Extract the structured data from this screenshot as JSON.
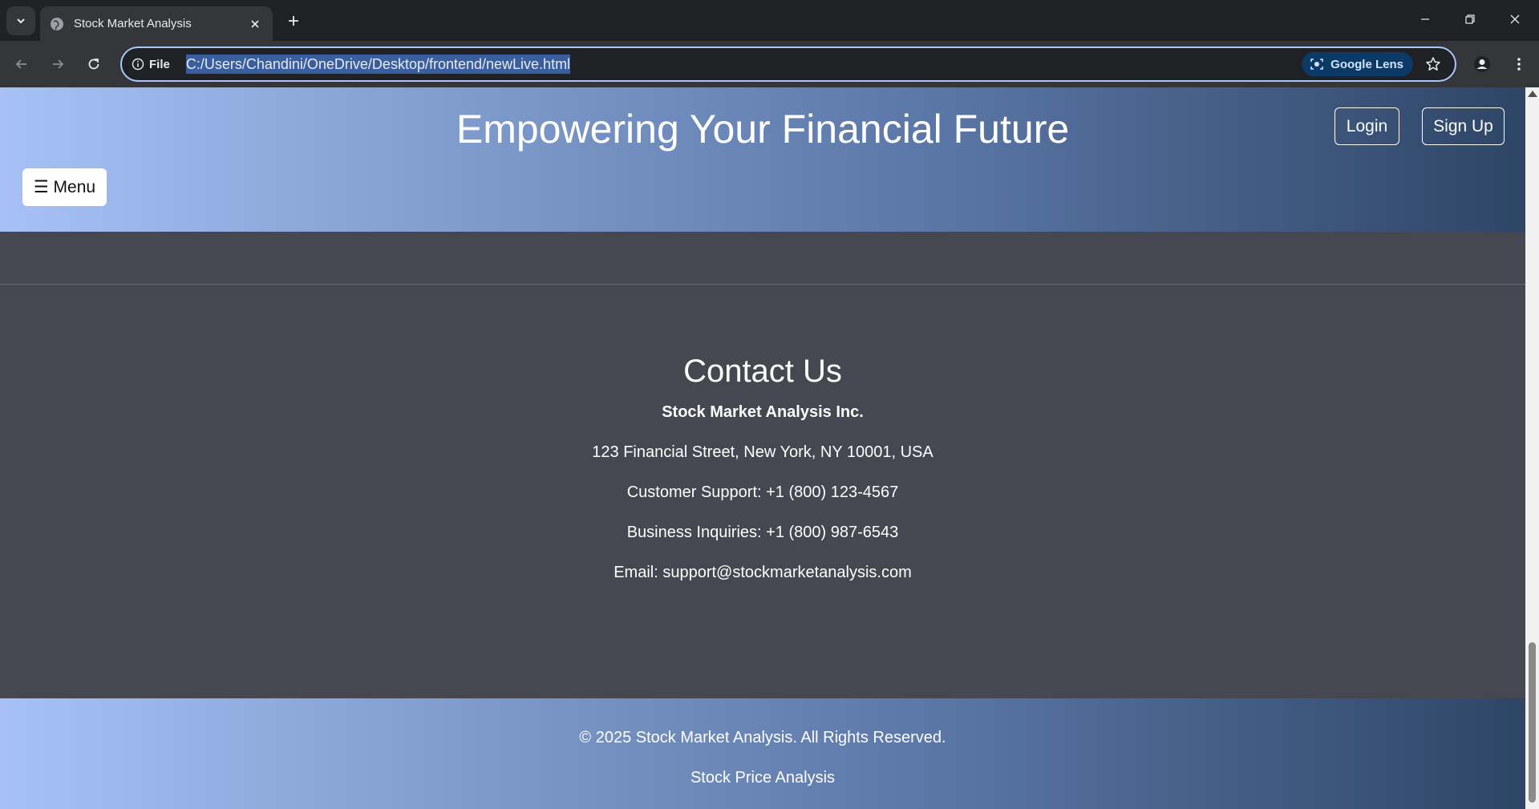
{
  "browser": {
    "tab_title": "Stock Market Analysis",
    "site_info_label": "File",
    "url": "C:/Users/Chandini/OneDrive/Desktop/frontend/newLive.html",
    "lens_label": "Google Lens"
  },
  "header": {
    "title": "Empowering Your Financial Future",
    "login_label": "Login",
    "signup_label": "Sign Up",
    "menu_label": "☰ Menu"
  },
  "contact": {
    "heading": "Contact Us",
    "company": "Stock Market Analysis Inc.",
    "address": "123 Financial Street, New York, NY 10001, USA",
    "support": "Customer Support: +1 (800) 123-4567",
    "business": "Business Inquiries: +1 (800) 987-6543",
    "email": "Email: support@stockmarketanalysis.com"
  },
  "footer": {
    "copyright": "© 2025 Stock Market Analysis. All Rights Reserved.",
    "link": "Stock Price Analysis"
  },
  "icons": {
    "tab_search": "chevron-down-icon",
    "favicon": "globe-icon",
    "tab_close": "close-icon",
    "new_tab": "plus-icon",
    "back": "arrow-left-icon",
    "forward": "arrow-right-icon",
    "reload": "reload-icon",
    "info": "info-icon",
    "lens": "camera-search-icon",
    "bookmark": "star-icon",
    "profile": "person-icon",
    "more": "kebab-icon"
  }
}
